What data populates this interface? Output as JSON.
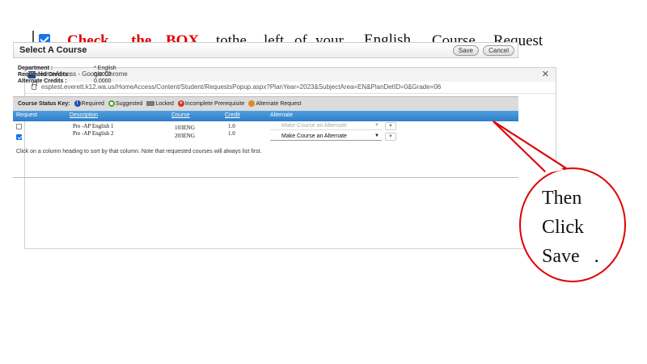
{
  "instruction": {
    "words": [
      "Check",
      "the",
      "BOX",
      "tothe",
      "left",
      "of",
      "your",
      "English",
      "Course",
      "Request"
    ]
  },
  "browser": {
    "favicon": "HAC",
    "title": "HomeAccess - Google Chrome",
    "url": "esptest.everett.k12.wa.us/HomeAccess/Content/Student/RequestsPopup.aspx?PlanYear=2023&SubjectArea=EN&PlanDetID=0&Grade=06"
  },
  "dialog": {
    "title": "Select A Course",
    "save_label": "Save",
    "cancel_label": "Cancel",
    "info": [
      {
        "label": "Department :",
        "value": "* English"
      },
      {
        "label": "Requested Credits :",
        "value": "0.0000"
      },
      {
        "label": "Alternate Credits :",
        "value": "0.0000"
      }
    ],
    "status_key": {
      "label": "Course Status Key:",
      "items": [
        {
          "icon": "required-icon",
          "label": "Required",
          "color": "#1f4fa8"
        },
        {
          "icon": "suggested-icon",
          "label": "Suggested",
          "color": "#5aa02c"
        },
        {
          "icon": "locked-icon",
          "label": "Locked",
          "color": "#777777"
        },
        {
          "icon": "incomplete-prerequisite-icon",
          "label": "Incomplete Prerequisite",
          "color": "#d03a2a"
        },
        {
          "icon": "alternate-request-icon",
          "label": "Alternate Request",
          "color": "#e08a1a"
        }
      ]
    },
    "table": {
      "headers": [
        "Request",
        "Description",
        "Course",
        "Credit",
        "Alternate"
      ],
      "rows": [
        {
          "checked": false,
          "description": "Pre -AP English  1",
          "course": "103ENG",
          "credit": "1.0",
          "alternate": "Make Course an Alternate",
          "alternate_enabled": false
        },
        {
          "checked": true,
          "description": "Pre -AP English  2",
          "course": "203ENG",
          "credit": "1.0",
          "alternate": "Make Course an Alternate",
          "alternate_enabled": true
        }
      ]
    },
    "footer_note": "Click on a column heading to sort by that column. Note that requested courses will always list first."
  },
  "callout": {
    "text": "Then\nClick\nSave   ."
  },
  "colors": {
    "accent_red": "#e00000",
    "header_blue": "#2f7dc7"
  }
}
